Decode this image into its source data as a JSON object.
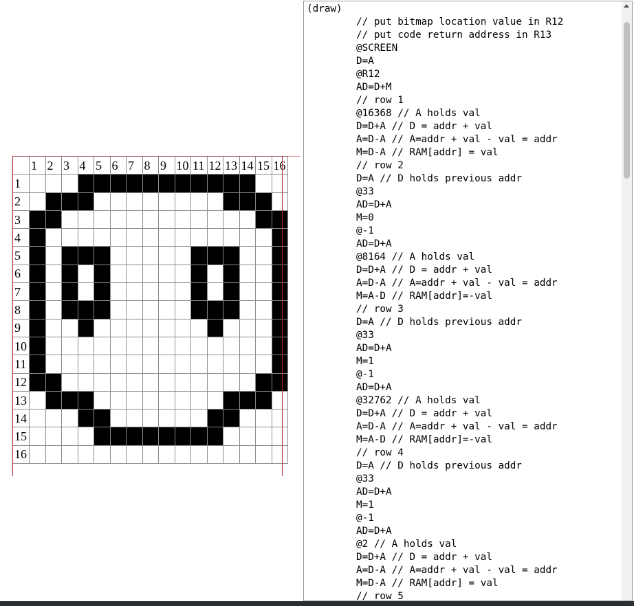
{
  "grid": {
    "column_headers": [
      "1",
      "2",
      "3",
      "4",
      "5",
      "6",
      "7",
      "8",
      "9",
      "10",
      "11",
      "12",
      "13",
      "14",
      "15",
      "16"
    ],
    "row_headers": [
      "1",
      "2",
      "3",
      "4",
      "5",
      "6",
      "7",
      "8",
      "9",
      "10",
      "11",
      "12",
      "13",
      "14",
      "15",
      "16"
    ],
    "bitmap": [
      "0001111111111100",
      "0111000000001110",
      "1100000000000011",
      "1000000000000001",
      "1011100000111001",
      "1010100000101001",
      "1010100000101001",
      "1011100000111001",
      "1001000000010001",
      "1000000000000001",
      "1000000000000001",
      "1100000000000011",
      "0111000000001110",
      "0001100000011000",
      "0000111111110000",
      "0000000000000000"
    ],
    "on_color": "#000000",
    "off_color": "#ffffff",
    "border_color": "#b0282c"
  },
  "code": {
    "lines": [
      {
        "text": "(draw)",
        "indent": false
      },
      {
        "text": "// put bitmap location value in R12",
        "indent": true
      },
      {
        "text": "// put code return address in R13",
        "indent": true
      },
      {
        "text": "@SCREEN",
        "indent": true
      },
      {
        "text": "D=A",
        "indent": true
      },
      {
        "text": "@R12",
        "indent": true
      },
      {
        "text": "AD=D+M",
        "indent": true
      },
      {
        "text": "// row 1",
        "indent": true
      },
      {
        "text": "@16368 // A holds val",
        "indent": true
      },
      {
        "text": "D=D+A // D = addr + val",
        "indent": true
      },
      {
        "text": "A=D-A // A=addr + val - val = addr",
        "indent": true
      },
      {
        "text": "M=D-A // RAM[addr] = val",
        "indent": true
      },
      {
        "text": "// row 2",
        "indent": true
      },
      {
        "text": "D=A // D holds previous addr",
        "indent": true
      },
      {
        "text": "@33",
        "indent": true
      },
      {
        "text": "AD=D+A",
        "indent": true
      },
      {
        "text": "M=0",
        "indent": true
      },
      {
        "text": "@-1",
        "indent": true
      },
      {
        "text": "AD=D+A",
        "indent": true
      },
      {
        "text": "@8164 // A holds val",
        "indent": true
      },
      {
        "text": "D=D+A // D = addr + val",
        "indent": true
      },
      {
        "text": "A=D-A // A=addr + val - val = addr",
        "indent": true
      },
      {
        "text": "M=A-D // RAM[addr]=-val",
        "indent": true
      },
      {
        "text": "// row 3",
        "indent": true
      },
      {
        "text": "D=A // D holds previous addr",
        "indent": true
      },
      {
        "text": "@33",
        "indent": true
      },
      {
        "text": "AD=D+A",
        "indent": true
      },
      {
        "text": "M=1",
        "indent": true
      },
      {
        "text": "@-1",
        "indent": true
      },
      {
        "text": "AD=D+A",
        "indent": true
      },
      {
        "text": "@32762 // A holds val",
        "indent": true
      },
      {
        "text": "D=D+A // D = addr + val",
        "indent": true
      },
      {
        "text": "A=D-A // A=addr + val - val = addr",
        "indent": true
      },
      {
        "text": "M=A-D // RAM[addr]=-val",
        "indent": true
      },
      {
        "text": "// row 4",
        "indent": true
      },
      {
        "text": "D=A // D holds previous addr",
        "indent": true
      },
      {
        "text": "@33",
        "indent": true
      },
      {
        "text": "AD=D+A",
        "indent": true
      },
      {
        "text": "M=1",
        "indent": true
      },
      {
        "text": "@-1",
        "indent": true
      },
      {
        "text": "AD=D+A",
        "indent": true
      },
      {
        "text": "@2 // A holds val",
        "indent": true
      },
      {
        "text": "D=D+A // D = addr + val",
        "indent": true
      },
      {
        "text": "A=D-A // A=addr + val - val = addr",
        "indent": true
      },
      {
        "text": "M=D-A // RAM[addr] = val",
        "indent": true
      },
      {
        "text": "// row 5",
        "indent": true
      }
    ]
  }
}
